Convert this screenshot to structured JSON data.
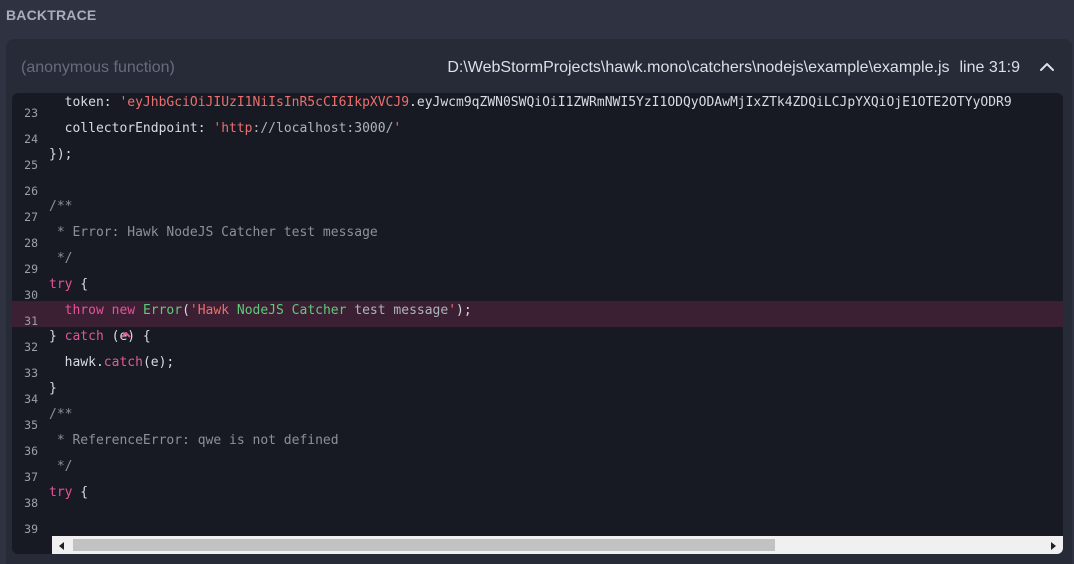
{
  "section": {
    "title": "BACKTRACE"
  },
  "frame": {
    "function_name": "(anonymous function)",
    "file_path": "D:\\WebStormProjects\\hawk.mono\\catchers\\nodejs\\example\\example.js",
    "line_ref": "line 31:9",
    "collapse_icon": "chevron-up-icon"
  },
  "code": {
    "highlighted_line": "31",
    "lines": [
      {
        "num": "23",
        "tokens": [
          {
            "t": "  token: ",
            "c": ""
          },
          {
            "t": "'eyJhbGciOiJIUzI1NiIsInR5cCI6IkpXVCJ9",
            "c": "str"
          },
          {
            "t": ".eyJwcm9qZWN0SWQiOiI1ZWRmNWI5YzI1ODQyODAwMjIxZTk4ZDQiLCJpYXQiOjE1OTE2OTYyODR9",
            "c": ""
          }
        ]
      },
      {
        "num": "24",
        "tokens": [
          {
            "t": "  collectorEndpoint: ",
            "c": ""
          },
          {
            "t": "'http",
            "c": "str"
          },
          {
            "t": "://localhost:3000/",
            "c": "strg"
          },
          {
            "t": "'",
            "c": "str"
          }
        ]
      },
      {
        "num": "25",
        "tokens": [
          {
            "t": "});",
            "c": ""
          }
        ]
      },
      {
        "num": "26",
        "tokens": []
      },
      {
        "num": "27",
        "tokens": [
          {
            "t": "/**",
            "c": "cm"
          }
        ]
      },
      {
        "num": "28",
        "tokens": [
          {
            "t": " * Error: Hawk NodeJS Catcher test message",
            "c": "cm"
          }
        ]
      },
      {
        "num": "29",
        "tokens": [
          {
            "t": " */",
            "c": "cm"
          }
        ]
      },
      {
        "num": "30",
        "tokens": [
          {
            "t": "try",
            "c": "kw"
          },
          {
            "t": " {",
            "c": ""
          }
        ]
      },
      {
        "num": "31",
        "tokens": [
          {
            "t": "  ",
            "c": ""
          },
          {
            "t": "throw",
            "c": "kw"
          },
          {
            "t": " ",
            "c": ""
          },
          {
            "t": "new",
            "c": "kw"
          },
          {
            "t": " ",
            "c": ""
          },
          {
            "t": "Error",
            "c": "cls"
          },
          {
            "t": "(",
            "c": ""
          },
          {
            "t": "'Hawk ",
            "c": "str"
          },
          {
            "t": "NodeJS Catcher",
            "c": "cls"
          },
          {
            "t": " test message",
            "c": "strg"
          },
          {
            "t": "'",
            "c": "str"
          },
          {
            "t": ");",
            "c": ""
          }
        ]
      },
      {
        "num": "32",
        "tokens": [
          {
            "t": "} ",
            "c": ""
          },
          {
            "t": "catch",
            "c": "kw"
          },
          {
            "t": " (e) {",
            "c": ""
          }
        ]
      },
      {
        "num": "33",
        "tokens": [
          {
            "t": "  hawk.",
            "c": ""
          },
          {
            "t": "catch",
            "c": "fn"
          },
          {
            "t": "(e);",
            "c": ""
          }
        ]
      },
      {
        "num": "34",
        "tokens": [
          {
            "t": "}",
            "c": ""
          }
        ]
      },
      {
        "num": "35",
        "tokens": [
          {
            "t": "/**",
            "c": "cm"
          }
        ]
      },
      {
        "num": "36",
        "tokens": [
          {
            "t": " * ReferenceError: qwe is not defined",
            "c": "cm"
          }
        ]
      },
      {
        "num": "37",
        "tokens": [
          {
            "t": " */",
            "c": "cm"
          }
        ]
      },
      {
        "num": "38",
        "tokens": [
          {
            "t": "try",
            "c": "kw"
          },
          {
            "t": " {",
            "c": ""
          }
        ]
      },
      {
        "num": "39",
        "tokens": []
      }
    ]
  },
  "colors": {
    "highlight_row": "#3b1f33",
    "keyword": "#e4549b",
    "class": "#5fc97a",
    "string": "#ec6f6f"
  }
}
